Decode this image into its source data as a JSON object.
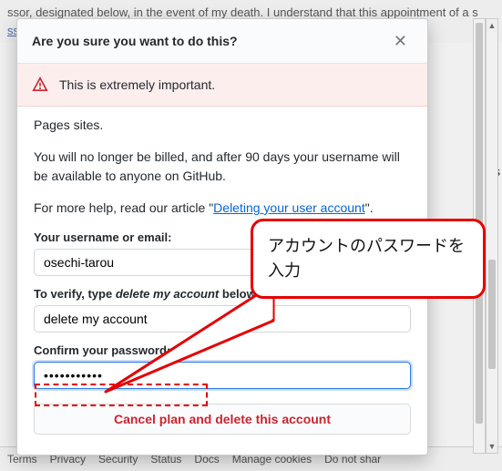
{
  "background": {
    "text_fragment": "ssor, designated below, in the event of my death. I understand that this appointment of a s",
    "link_fragment": "sso",
    "right_fragment": "a s"
  },
  "modal": {
    "title": "Are you sure you want to do this?",
    "alert_text": "This is extremely important.",
    "body_line1": "Pages sites.",
    "body_line2": "You will no longer be billed, and after 90 days your username will be available to anyone on GitHub.",
    "body_help_prefix": "For more help, read our article \"",
    "body_help_link": "Deleting your user account",
    "body_help_suffix": "\".",
    "fields": {
      "username_label": "Your username or email:",
      "username_value": "osechi-tarou",
      "verify_label_prefix": "To verify, type ",
      "verify_phrase": "delete my account",
      "verify_label_suffix": " below:",
      "verify_value": "delete my account",
      "password_label": "Confirm your password:",
      "password_value": "•••••••••••"
    },
    "submit_button": "Cancel plan and delete this account"
  },
  "callout": {
    "text": "アカウントのパスワードを入力"
  },
  "footer": {
    "items": [
      "Terms",
      "Privacy",
      "Security",
      "Status",
      "Docs",
      "Manage cookies",
      "Do not shar"
    ]
  }
}
